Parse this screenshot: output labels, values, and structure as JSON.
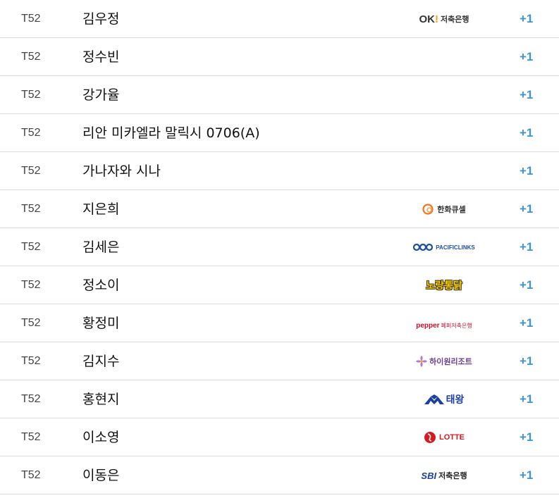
{
  "rows": [
    {
      "rank": "T52",
      "name": "김우정",
      "sponsor": {
        "type": "ok",
        "mark": "OK",
        "bang": "!",
        "text": "저축은행"
      },
      "change": "+1"
    },
    {
      "rank": "T52",
      "name": "정수빈",
      "sponsor": null,
      "change": "+1"
    },
    {
      "rank": "T52",
      "name": "강가율",
      "sponsor": null,
      "change": "+1"
    },
    {
      "rank": "T52",
      "name": "리안 미카엘라 말릭시 0706(A)",
      "sponsor": null,
      "change": "+1"
    },
    {
      "rank": "T52",
      "name": "가나자와 시나",
      "sponsor": null,
      "change": "+1"
    },
    {
      "rank": "T52",
      "name": "지은희",
      "sponsor": {
        "type": "hanwha",
        "text": "한화큐셀"
      },
      "change": "+1"
    },
    {
      "rank": "T52",
      "name": "김세은",
      "sponsor": {
        "type": "pacific",
        "text": "PACIFICLINKS"
      },
      "change": "+1"
    },
    {
      "rank": "T52",
      "name": "정소이",
      "sponsor": {
        "type": "norang",
        "text": "노랑통닭"
      },
      "change": "+1"
    },
    {
      "rank": "T52",
      "name": "황정미",
      "sponsor": {
        "type": "pepper",
        "text": "pepper",
        "sub": "페퍼저축은행"
      },
      "change": "+1"
    },
    {
      "rank": "T52",
      "name": "김지수",
      "sponsor": {
        "type": "high1",
        "text": "하이원리조트"
      },
      "change": "+1"
    },
    {
      "rank": "T52",
      "name": "홍현지",
      "sponsor": {
        "type": "taeyoung",
        "text": "태왕"
      },
      "change": "+1"
    },
    {
      "rank": "T52",
      "name": "이소영",
      "sponsor": {
        "type": "lotte",
        "text": "LOTTE"
      },
      "change": "+1"
    },
    {
      "rank": "T52",
      "name": "이동은",
      "sponsor": {
        "type": "sbi",
        "mark": "SBI",
        "text": "저축은행"
      },
      "change": "+1"
    }
  ],
  "colors": {
    "change": "#3d94d1",
    "row_border": "#dcdcdc"
  }
}
